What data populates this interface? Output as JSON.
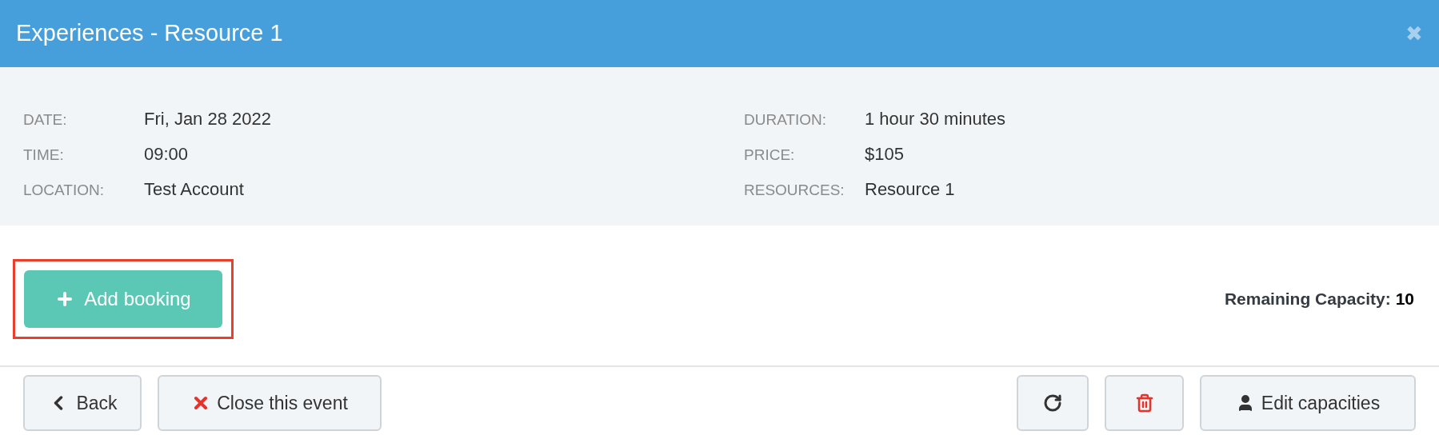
{
  "window": {
    "title": "Experiences - Resource 1",
    "close_symbol": "✖"
  },
  "details": {
    "left": [
      {
        "label": "DATE:",
        "value": "Fri, Jan 28 2022"
      },
      {
        "label": "TIME:",
        "value": "09:00"
      },
      {
        "label": "LOCATION:",
        "value": "Test Account"
      }
    ],
    "right": [
      {
        "label": "DURATION:",
        "value": "1 hour 30 minutes"
      },
      {
        "label": "PRICE:",
        "value": "$105"
      },
      {
        "label": "RESOURCES:",
        "value": "Resource 1"
      }
    ]
  },
  "add_button": {
    "label": "Add booking",
    "highlighted": true
  },
  "capacity": {
    "label": "Remaining Capacity:",
    "value": "10"
  },
  "footer": {
    "left": [
      {
        "kind": "back",
        "label": "Back"
      },
      {
        "kind": "close",
        "label": "Close this event"
      }
    ],
    "right": [
      {
        "kind": "refresh"
      },
      {
        "kind": "delete"
      },
      {
        "kind": "edit",
        "label": "Edit capacities"
      }
    ]
  }
}
